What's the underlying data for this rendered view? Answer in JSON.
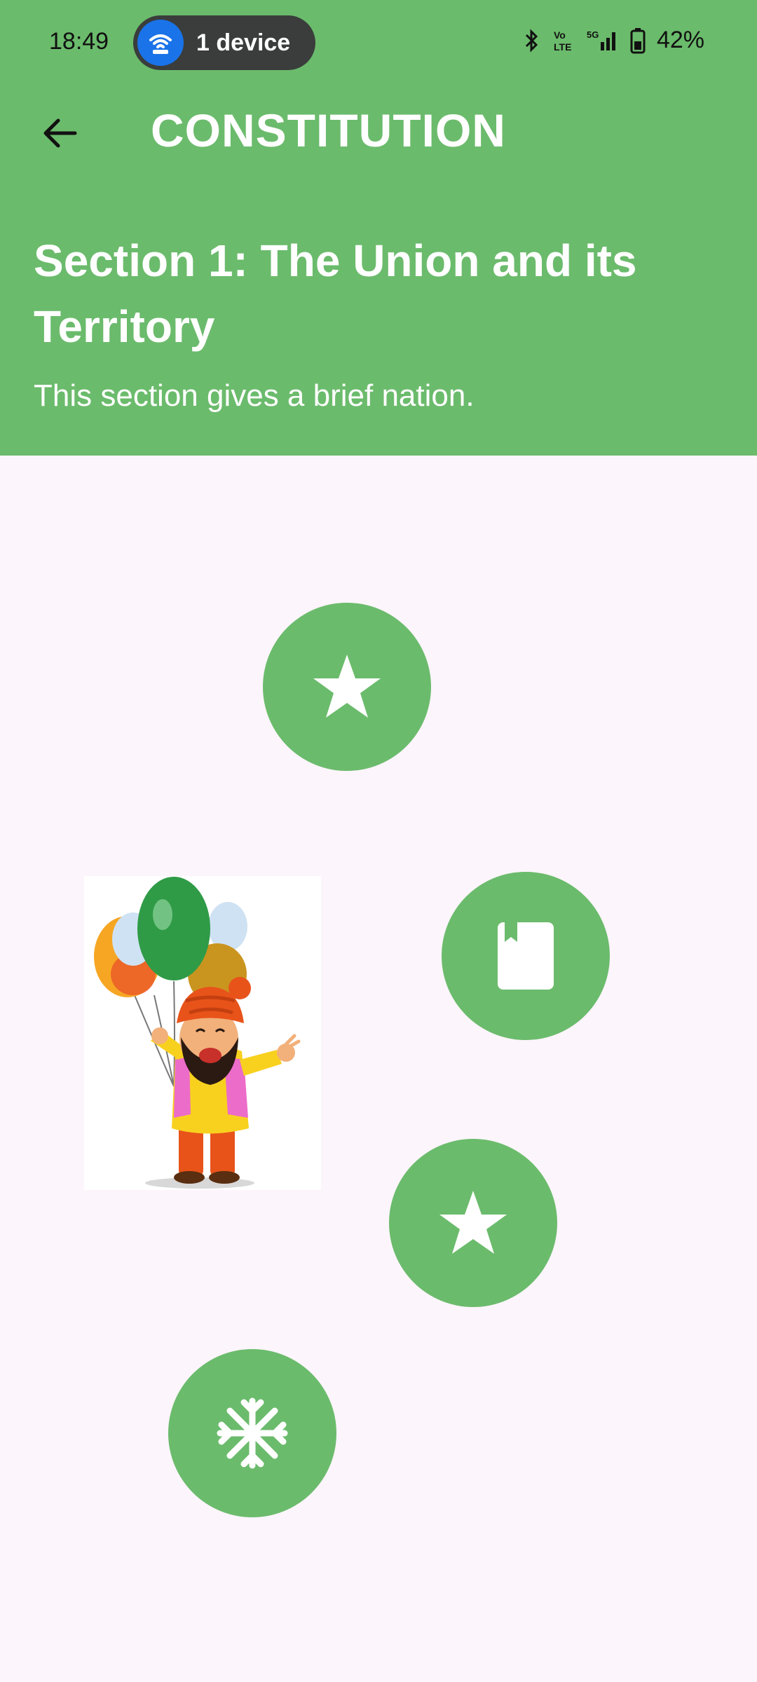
{
  "status_bar": {
    "time": "18:49",
    "device_pill": "1 device",
    "battery": "42%"
  },
  "app_bar": {
    "title": "CONSTITUTION",
    "back_icon": "arrow-left-icon"
  },
  "section": {
    "title": "Section 1: The Union and its Territory",
    "subtitle": "This section gives a brief nation."
  },
  "path_nodes": [
    {
      "icon": "star-icon"
    },
    {
      "icon": "book-icon"
    },
    {
      "icon": "star-icon"
    },
    {
      "icon": "snowflake-icon"
    }
  ],
  "colors": {
    "header_bg": "#6bbb6c",
    "node_bg": "#6bbb6c",
    "page_bg": "#fcf5fb",
    "pill_bg": "#3a3d3c",
    "pill_icon_bg": "#1a73e8"
  }
}
